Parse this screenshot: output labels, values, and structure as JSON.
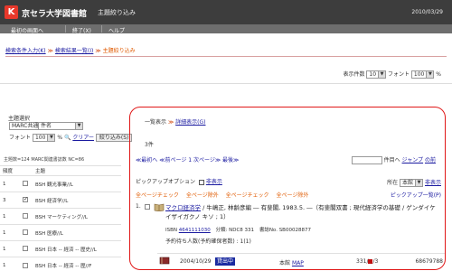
{
  "header": {
    "logo_letter": "K",
    "app_title": "京セラ大学図書館",
    "page_heading": "主題絞り込み",
    "date": "2010/03/29"
  },
  "nav": {
    "items": [
      {
        "label": "最初の画面へ"
      },
      {
        "label": "終了(X)"
      },
      {
        "label": "ヘルプ"
      }
    ]
  },
  "breadcrumb": {
    "items": [
      "検索条件入力(K)",
      "検索結果一覧(I)",
      "主題絞り込み"
    ],
    "separator": "≫"
  },
  "display_controls": {
    "count_label": "表示件数",
    "count_value": "10",
    "font_label": "フォント",
    "font_value": "100",
    "percent": "%"
  },
  "left_panel": {
    "subject_select_label": "主題選択",
    "marc_select_value": "MARC共通",
    "field_select_value": "件名",
    "font_label": "フォント",
    "font_value": "100",
    "percent": "%",
    "clear_label": "クリアー",
    "narrow_button": "絞り込み(S)",
    "stats": "主題数=124 MARC関連書誌数 NC=86",
    "table_headers": {
      "freq": "頻度",
      "subject": "主題"
    },
    "rows": [
      {
        "freq": "1",
        "checked": false,
        "subject": "BSH 観光事業//L"
      },
      {
        "freq": "3",
        "checked": true,
        "subject": "BSH 経済学//L"
      },
      {
        "freq": "1",
        "checked": false,
        "subject": "BSH マーケティング//L"
      },
      {
        "freq": "1",
        "checked": false,
        "subject": "BSH 医療//L"
      },
      {
        "freq": "1",
        "checked": false,
        "subject": "BSH 日本 -- 経済 -- 歴史//L"
      },
      {
        "freq": "1",
        "checked": false,
        "subject": "BSH 日本 -- 経済 -- 歴//F"
      }
    ]
  },
  "results": {
    "tab_list": "一覧表示",
    "tab_sep": "≫",
    "tab_detail": "詳細表示(G)",
    "count": "3件",
    "pager": "≪最初へ ≪前ページ 1 次ページ≫ 最後≫",
    "goto_suffix": "件目へ",
    "goto_link": "ジャンプ",
    "goto_link2": "の前",
    "pickup_label": "ピックアップオプション",
    "hide_label": "非表示",
    "sort_prefix": "所在",
    "sort_value": "本館",
    "sort_hide": "非表示",
    "actions": [
      "全ページチェック",
      "全ページ除外",
      "全ページチェック",
      "全ページ除外"
    ],
    "pickup_help": "ピックアップ一覧(P)",
    "record": {
      "number": "1.",
      "title_link": "マクロ経済学",
      "title_rest": " / 牛嶋正, 林齢彦編 ― 有斐閣, 1983.5. ―（有斐閣双書 ; 現代経済学の基礎 / ゲンダイケイザイガクノ キソ ; 1）",
      "isbn_label": "ISBN",
      "isbn": "4641111030",
      "ndc": "分類: NDC8 331",
      "book_no": "書誌No. SB00028877",
      "reserve": "予約待ち人数(予約確保者数) : 1(1)"
    },
    "holding": {
      "date": "2004/10/29",
      "status": "貸出中",
      "location_label": "本館",
      "location_link": "MAP",
      "call_no": "331/",
      "call_suffix": "/3",
      "item_id": "68679788",
      "marker_color": "#c01010"
    }
  }
}
